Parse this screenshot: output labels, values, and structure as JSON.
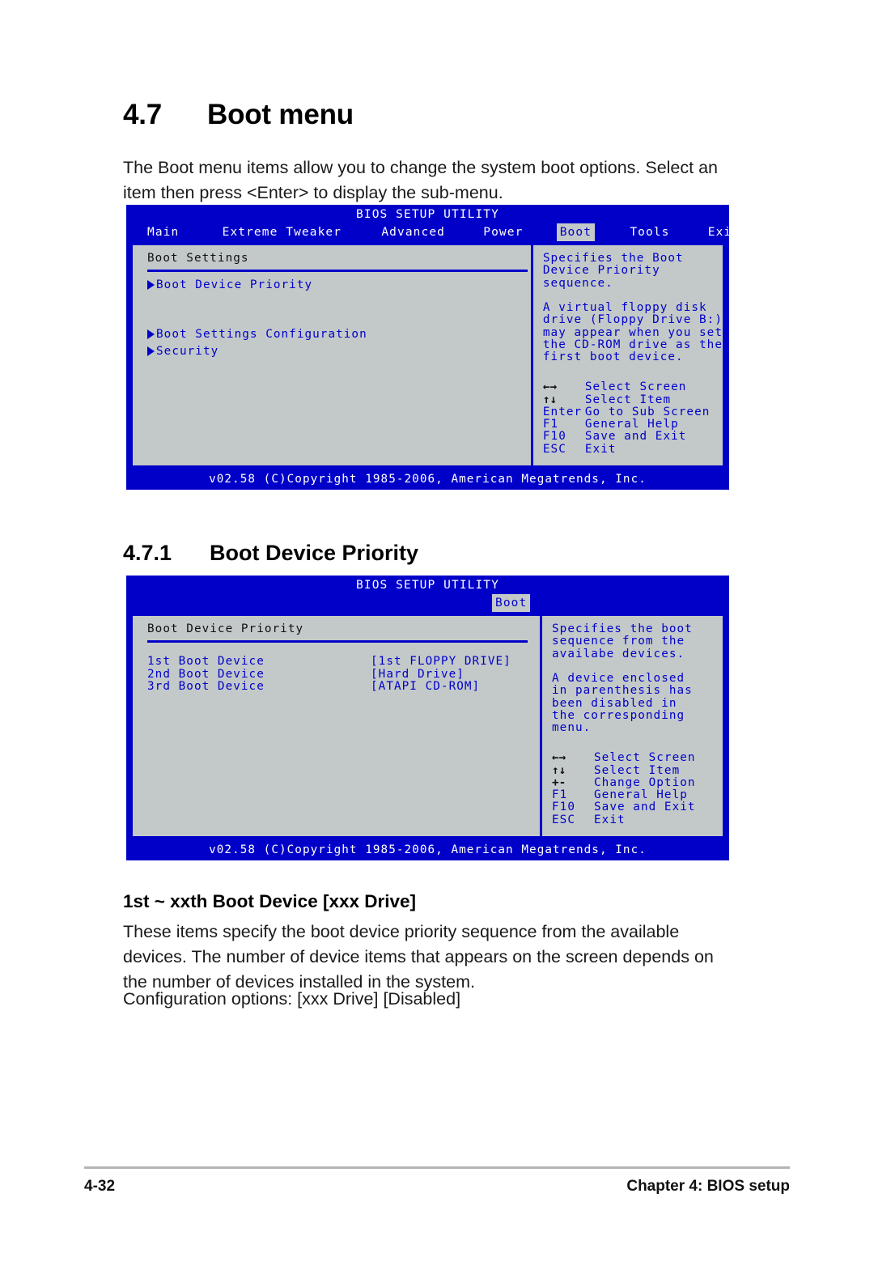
{
  "document": {
    "section": {
      "number": "4.7",
      "title": "Boot menu"
    },
    "intro": "The Boot menu items allow you to change the system boot options. Select an item then press <Enter> to display the sub-menu.",
    "subsection": {
      "number": "4.7.1",
      "title": "Boot Device Priority"
    },
    "subheading": "1st ~ xxth Boot Device [xxx Drive]",
    "body": "These items specify the boot device priority sequence from the available devices. The number of device items that appears on the screen depends on the number of devices installed in the system.",
    "config_options": "Configuration options: [xxx Drive] [Disabled]",
    "footer": {
      "page": "4-32",
      "chapter": "Chapter 4: BIOS setup"
    }
  },
  "colors": {
    "bios_blue": "#0000c8",
    "bios_gray": "#c3c9c9",
    "bios_white": "#ffffff",
    "text_black": "#101010"
  },
  "bios_screen_1": {
    "title": "BIOS SETUP UTILITY",
    "menu": [
      {
        "label": "Main",
        "active": false
      },
      {
        "label": "Extreme Tweaker",
        "active": false
      },
      {
        "label": "Advanced",
        "active": false
      },
      {
        "label": "Power",
        "active": false
      },
      {
        "label": "Boot",
        "active": true
      },
      {
        "label": "Tools",
        "active": false
      },
      {
        "label": "Exit",
        "active": false
      }
    ],
    "panel_title": "Boot Settings",
    "items": [
      {
        "label": "Boot Device Priority"
      },
      {
        "label": "Boot Settings Configuration"
      },
      {
        "label": "Security"
      }
    ],
    "help": [
      "Specifies the Boot",
      "Device Priority",
      "sequence.",
      "",
      "A virtual floppy disk",
      "drive (Floppy Drive B:)",
      "may appear when you set",
      "the CD-ROM drive as the",
      "first boot device."
    ],
    "legend": [
      {
        "key": "←→",
        "glyph": true,
        "action": "Select Screen"
      },
      {
        "key": "↑↓",
        "glyph": true,
        "action": "Select Item"
      },
      {
        "key": "Enter",
        "glyph": false,
        "action": "Go to Sub Screen"
      },
      {
        "key": "F1",
        "glyph": false,
        "action": "General Help"
      },
      {
        "key": "F10",
        "glyph": false,
        "action": "Save and Exit"
      },
      {
        "key": "ESC",
        "glyph": false,
        "action": "Exit"
      }
    ],
    "footer": "v02.58 (C)Copyright 1985-2006, American Megatrends, Inc."
  },
  "bios_screen_2": {
    "title": "BIOS SETUP UTILITY",
    "menu": [
      {
        "label": "Boot",
        "active": true
      }
    ],
    "panel_title": "Boot Device Priority",
    "rows": [
      {
        "key": "1st Boot Device",
        "value": "[1st FLOPPY DRIVE]"
      },
      {
        "key": "2nd Boot Device",
        "value": "[Hard Drive]"
      },
      {
        "key": "3rd Boot Device",
        "value": "[ATAPI CD-ROM]"
      }
    ],
    "help": [
      "Specifies the boot",
      "sequence from the",
      "availabe devices.",
      "",
      "A device enclosed",
      "in parenthesis has",
      "been disabled in",
      "the corresponding",
      "menu."
    ],
    "legend": [
      {
        "key": "←→",
        "glyph": true,
        "action": "Select Screen"
      },
      {
        "key": "↑↓",
        "glyph": true,
        "action": "Select Item"
      },
      {
        "key": "+-",
        "glyph": true,
        "action": "Change Option"
      },
      {
        "key": "F1",
        "glyph": false,
        "action": "General Help"
      },
      {
        "key": "F10",
        "glyph": false,
        "action": "Save and Exit"
      },
      {
        "key": "ESC",
        "glyph": false,
        "action": "Exit"
      }
    ],
    "footer": "v02.58 (C)Copyright 1985-2006, American Megatrends, Inc."
  }
}
